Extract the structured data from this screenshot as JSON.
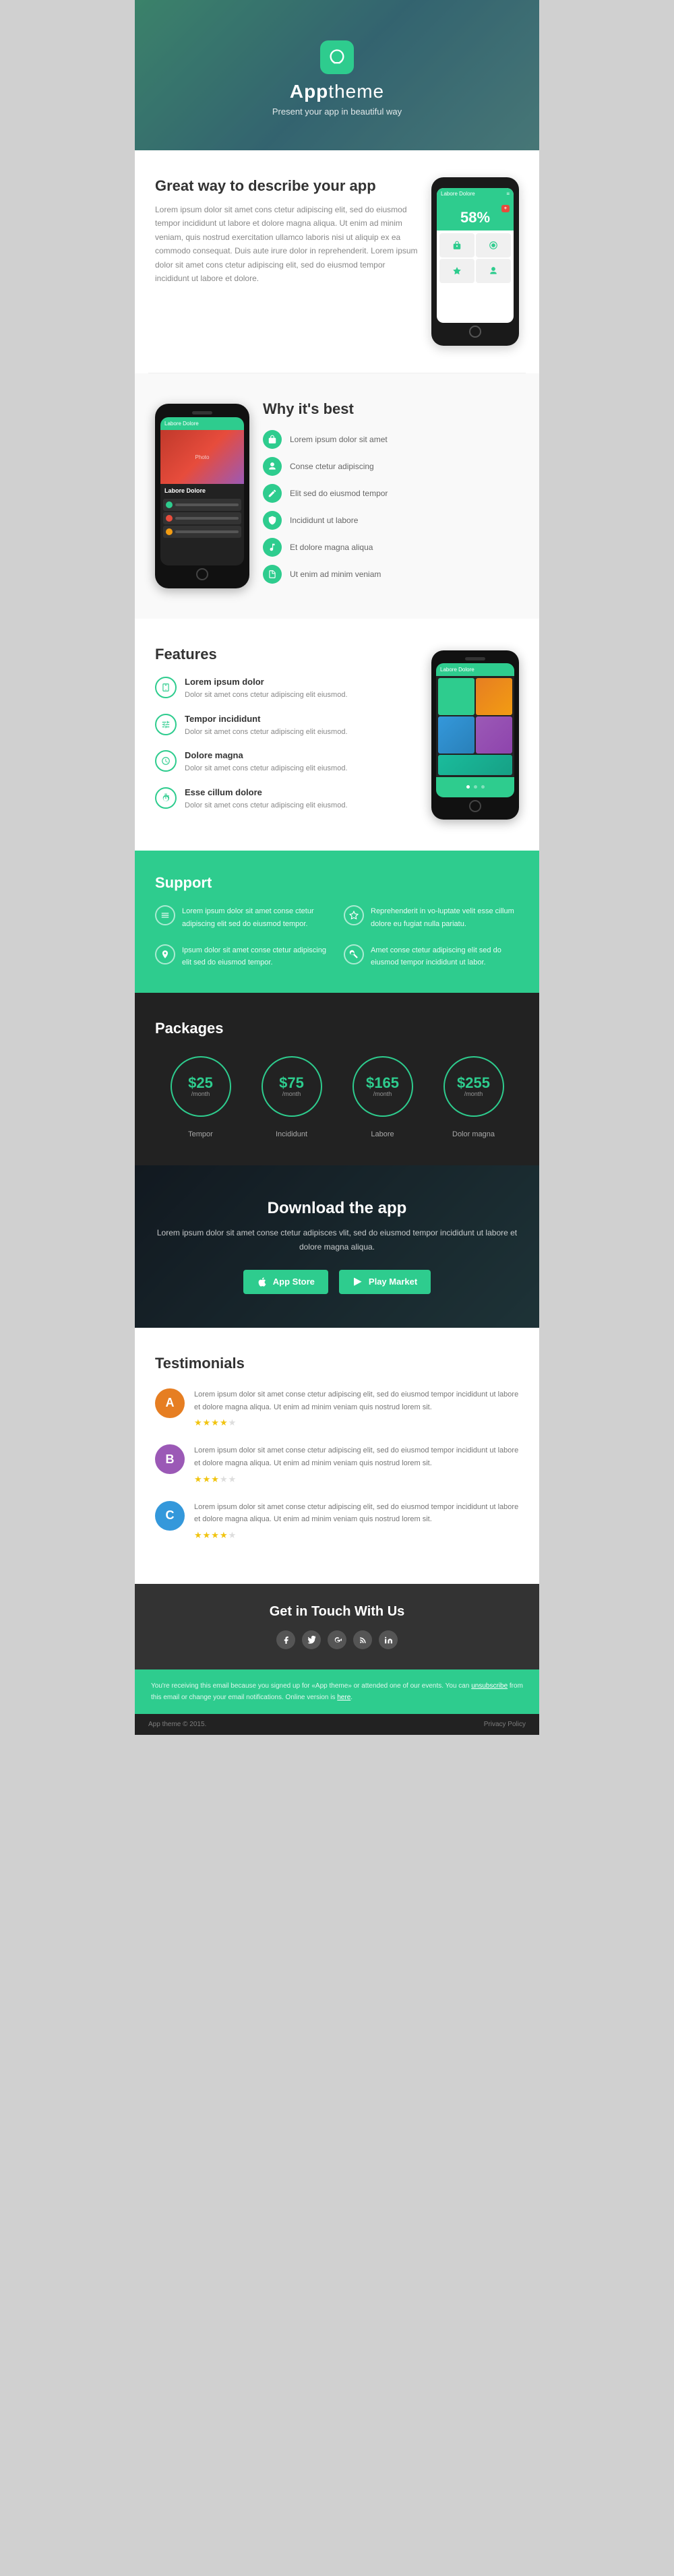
{
  "hero": {
    "logo_alt": "Apptheme logo",
    "title_prefix": "App",
    "title_suffix": "theme",
    "subtitle": "Present your app in beautiful way"
  },
  "section_describe": {
    "heading": "Great way to describe your app",
    "body": "Lorem ipsum dolor sit amet cons ctetur adipiscing elit, sed do eiusmod tempor incididunt ut labore et dolore magna aliqua. Ut enim ad minim veniam, quis nostrud exercitation ullamco laboris nisi ut aliquip ex ea commodo consequat. Duis aute irure dolor in reprehenderit. Lorem ipsum dolor sit amet cons ctetur adipiscing elit, sed do eiusmod tempor incididunt ut labore et dolore.",
    "phone_label": "Labore Dolore",
    "percent": "58%"
  },
  "section_why": {
    "heading": "Why it's best",
    "items": [
      {
        "id": "lock",
        "label": "Lorem ipsum dolor sit amet"
      },
      {
        "id": "person",
        "label": "Conse ctetur adipiscing"
      },
      {
        "id": "pencil",
        "label": "Elit sed do eiusmod tempor"
      },
      {
        "id": "shield",
        "label": "Incididunt ut labore"
      },
      {
        "id": "music",
        "label": "Et dolore magna aliqua"
      },
      {
        "id": "note",
        "label": "Ut enim ad minim veniam"
      }
    ]
  },
  "section_features": {
    "heading": "Features",
    "items": [
      {
        "title": "Lorem ipsum dolor",
        "desc": "Dolor sit amet cons ctetur adipiscing elit eiusmod."
      },
      {
        "title": "Tempor incididunt",
        "desc": "Dolor sit amet cons ctetur adipiscing elit eiusmod."
      },
      {
        "title": "Dolore magna",
        "desc": "Dolor sit amet cons ctetur adipiscing elit eiusmod."
      },
      {
        "title": "Esse cillum dolore",
        "desc": "Dolor sit amet cons ctetur adipiscing elit eiusmod."
      }
    ]
  },
  "section_support": {
    "heading": "Support",
    "items": [
      {
        "icon": "lines",
        "text": "Lorem ipsum dolor sit amet conse ctetur adipiscing elit sed do eiusmod tempor."
      },
      {
        "icon": "star",
        "text": "Reprehenderit in vo-luptate velit esse cillum dolore eu fugiat nulla pariatu."
      },
      {
        "icon": "location",
        "text": "Ipsum dolor sit amet conse ctetur adipiscing elit sed do eiusmod tempor."
      },
      {
        "icon": "key",
        "text": "Amet conse ctetur adipiscing elit sed do eiusmod tempor incididunt ut labor."
      }
    ]
  },
  "section_packages": {
    "heading": "Packages",
    "items": [
      {
        "price": "$25",
        "period": "/month",
        "label": "Tempor"
      },
      {
        "price": "$75",
        "period": "/month",
        "label": "Incididunt"
      },
      {
        "price": "$165",
        "period": "/month",
        "label": "Labore"
      },
      {
        "price": "$255",
        "period": "/month",
        "label": "Dolor magna"
      }
    ]
  },
  "section_download": {
    "heading": "Download the app",
    "body": "Lorem ipsum dolor sit amet conse ctetur adipisces vlit, sed do eiusmod tempor incididunt ut labore et dolore magna aliqua.",
    "btn_appstore": "App Store",
    "btn_playmarket": "Play Market"
  },
  "section_testimonials": {
    "heading": "Testimonials",
    "items": [
      {
        "color": "#e67e22",
        "initials": "A",
        "text": "Lorem ipsum dolor sit amet conse ctetur adipiscing elit, sed do eiusmod tempor incididunt ut labore et dolore magna aliqua. Ut enim ad minim veniam quis nostrud lorem sit.",
        "stars": 4,
        "max_stars": 5
      },
      {
        "color": "#9b59b6",
        "initials": "B",
        "text": "Lorem ipsum dolor sit amet conse ctetur adipiscing elit, sed do eiusmod tempor incididunt ut labore et dolore magna aliqua. Ut enim ad minim veniam quis nostrud lorem sit.",
        "stars": 3,
        "max_stars": 5
      },
      {
        "color": "#3498db",
        "initials": "C",
        "text": "Lorem ipsum dolor sit amet conse ctetur adipiscing elit, sed do eiusmod tempor incididunt ut labore et dolore magna aliqua. Ut enim ad minim veniam quis nostrud lorem sit.",
        "stars": 4,
        "max_stars": 5
      }
    ]
  },
  "section_contact": {
    "heading": "Get in Touch With Us",
    "social_icons": [
      "facebook",
      "twitter",
      "google-plus",
      "rss",
      "linkedin"
    ]
  },
  "footer": {
    "notice": "You're receiving this email because you signed up for «App theme» or attended one of our events. You can unsubscribe from this email or change your email notifications. Online version is here.",
    "copyright": "App theme © 2015.",
    "privacy": "Privacy Policy"
  },
  "brand_color": "#2ecc8e"
}
